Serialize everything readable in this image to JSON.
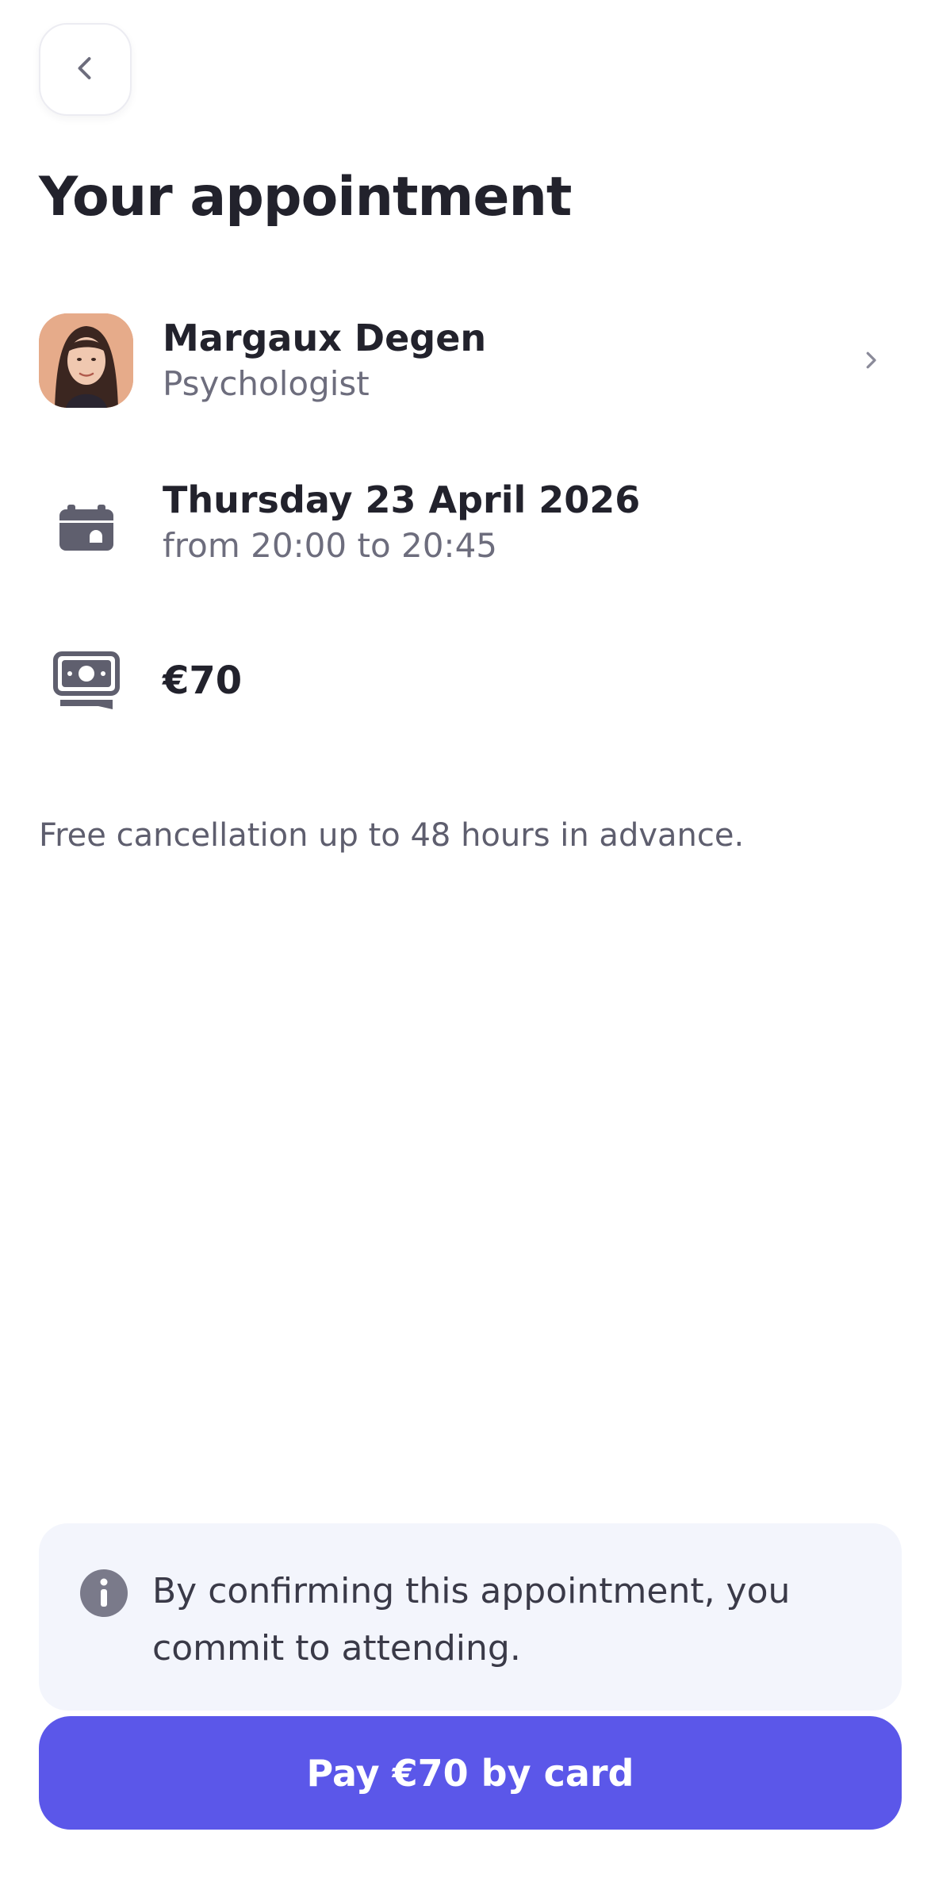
{
  "header": {
    "back_icon": "chevron-left-icon",
    "title": "Your appointment"
  },
  "practitioner": {
    "name": "Margaux Degen",
    "role": "Psychologist",
    "chevron_icon": "chevron-right-icon"
  },
  "schedule": {
    "icon": "calendar-icon",
    "date": "Thursday 23 April 2026",
    "time": "from 20:00 to 20:45"
  },
  "price": {
    "icon": "banknote-icon",
    "amount": "€70"
  },
  "cancellation_note": "Free cancellation up to 48 hours in advance.",
  "info": {
    "icon": "info-icon",
    "text": "By confirming this appointment, you commit to attending."
  },
  "pay_button": {
    "label": "Pay €70 by card"
  },
  "colors": {
    "accent": "#5b57e9",
    "info_background": "#f3f5fc",
    "icon_gray": "#5f5f6e"
  }
}
